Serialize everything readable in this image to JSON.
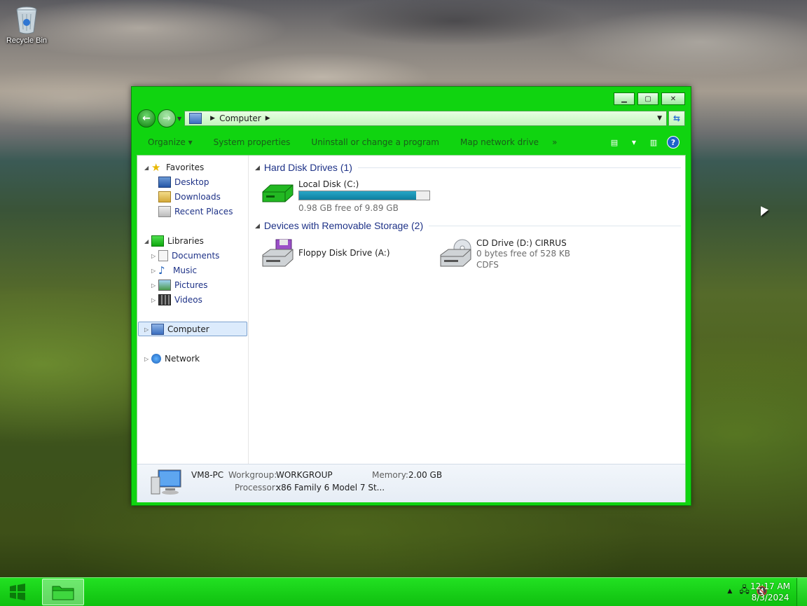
{
  "desktop": {
    "icons": [
      {
        "label": "Recycle Bin",
        "icon": "recycle-bin-icon"
      }
    ]
  },
  "window": {
    "title_buttons": {
      "minimize": "minimize",
      "maximize": "maximize",
      "close": "close"
    },
    "address": {
      "path": [
        "Computer"
      ],
      "icon": "computer-icon"
    },
    "commands": [
      "Organize ▾",
      "System properties",
      "Uninstall or change a program",
      "Map network drive",
      "»"
    ],
    "nav_pane": {
      "favorites": {
        "label": "Favorites",
        "items": [
          "Desktop",
          "Downloads",
          "Recent Places"
        ]
      },
      "libraries": {
        "label": "Libraries",
        "items": [
          "Documents",
          "Music",
          "Pictures",
          "Videos"
        ]
      },
      "computer": "Computer",
      "network": "Network"
    },
    "groups": {
      "hard_disk": {
        "title": "Hard Disk Drives (1)",
        "drives": [
          {
            "name": "Local Disk (C:)",
            "free_text": "0.98 GB free of 9.89 GB",
            "used_fraction": 0.9
          }
        ]
      },
      "removable": {
        "title": "Devices with Removable Storage (2)",
        "drives": [
          {
            "name": "Floppy Disk Drive (A:)"
          },
          {
            "name": "CD Drive (D:) CIRRUS",
            "free_text": "0 bytes free of 528 KB",
            "fs": "CDFS"
          }
        ]
      }
    },
    "details": {
      "pc_name": "VM8-PC",
      "workgroup_label": "Workgroup:",
      "workgroup": "WORKGROUP",
      "memory_label": "Memory:",
      "memory": "2.00 GB",
      "processor_label": "Processor:",
      "processor": "x86 Family 6 Model 7 St..."
    }
  },
  "taskbar": {
    "time": "12:17 AM",
    "date": "8/3/2024"
  },
  "colors": {
    "chrome": "#10d410",
    "taskbar": "#16c516",
    "link": "#1e3287",
    "progress": "#27a6c6"
  }
}
